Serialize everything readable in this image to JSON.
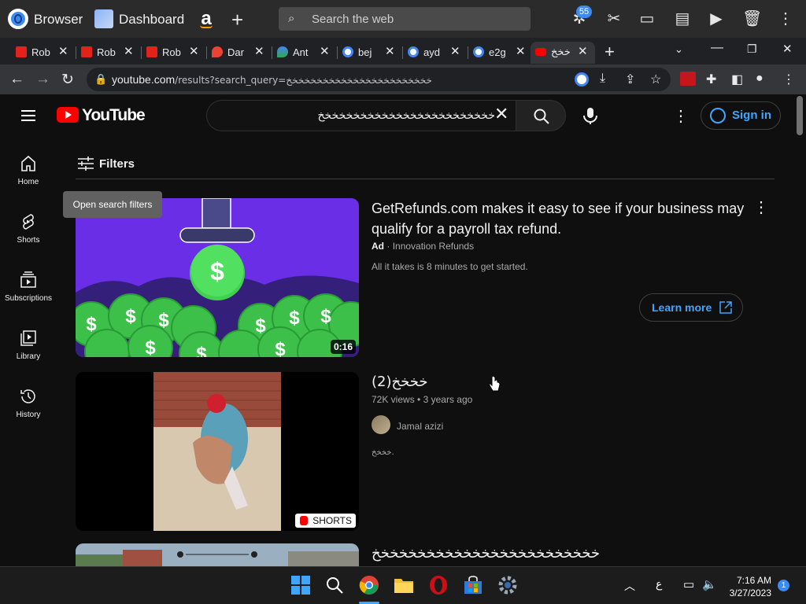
{
  "opera": {
    "browser_label": "Browser",
    "dashboard_label": "Dashboard",
    "amazon_glyph": "a",
    "search_placeholder": "Search the web",
    "badge_count": "55"
  },
  "tabs": [
    {
      "label": "Rob",
      "favicon": "roblox-icon",
      "color": "#e2231a"
    },
    {
      "label": "Rob",
      "favicon": "roblox-icon",
      "color": "#e2231a"
    },
    {
      "label": "Rob",
      "favicon": "roblox-icon",
      "color": "#e2231a"
    },
    {
      "label": "Dar",
      "favicon": "map-pin-icon",
      "color": "#ea4335"
    },
    {
      "label": "Ant",
      "favicon": "google-maps-icon",
      "color": "#34a853"
    },
    {
      "label": "bej",
      "favicon": "google-icon",
      "color": "#ffffff"
    },
    {
      "label": "ayd",
      "favicon": "google-icon",
      "color": "#ffffff"
    },
    {
      "label": "e2g",
      "favicon": "google-icon",
      "color": "#ffffff"
    },
    {
      "label": "خخخ",
      "favicon": "youtube-icon",
      "color": "#ff0000"
    }
  ],
  "address": {
    "domain": "youtube.com",
    "path": "/results?search_query=خخخخخخخخخخخخخخخخخخخخخخخخ"
  },
  "youtube": {
    "logo_text": "YouTube",
    "search_value": "خخخخخخخخخخخخخخخخخخخخخخخخخ",
    "signin_label": "Sign in",
    "sidebar": [
      {
        "label": "Home",
        "icon": "home-icon"
      },
      {
        "label": "Shorts",
        "icon": "shorts-icon"
      },
      {
        "label": "Subscriptions",
        "icon": "subscriptions-icon"
      },
      {
        "label": "Library",
        "icon": "library-icon"
      },
      {
        "label": "History",
        "icon": "history-icon"
      }
    ],
    "filters_label": "Filters",
    "tooltip": "Open search filters",
    "ad": {
      "title": "GetRefunds.com makes it easy to see if your business may qualify for a payroll tax refund.",
      "ad_label": "Ad",
      "advertiser": "Innovation Refunds",
      "description": "All it takes is 8 minutes to get started.",
      "duration": "0:16",
      "cta": "Learn more"
    },
    "video1": {
      "title": "خخخخ(2)",
      "views": "72K views",
      "age": "3 years ago",
      "channel": "Jamal azizi",
      "description": "خخخخ.",
      "badge": "SHORTS"
    },
    "video2": {
      "title": "خخخخخخخخخخخخخخخخخخخخخخخخخ"
    }
  },
  "taskbar": {
    "time": "7:16 AM",
    "date": "3/27/2023",
    "lang": "ع",
    "notifications": "1"
  },
  "colors": {
    "accent": "#3ea6ff",
    "brand_red": "#ff0000",
    "opera_blue": "#3c8cf0"
  }
}
